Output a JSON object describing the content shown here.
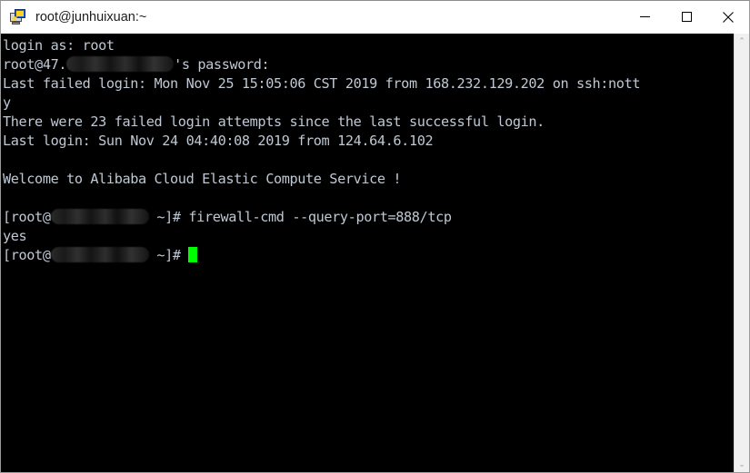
{
  "window": {
    "title": "root@junhuixuan:~",
    "icon": "putty-icon",
    "controls": {
      "minimize": "minimize-button",
      "maximize": "maximize-button",
      "close": "close-button"
    }
  },
  "terminal": {
    "background_color": "#000000",
    "text_color": "#bfc8d4",
    "cursor_color": "#00ff00",
    "lines": [
      {
        "id": "login-as",
        "text": "login as: root"
      },
      {
        "id": "password-prompt",
        "prefix": "root@47.",
        "redacted": true,
        "suffix": "'s password:"
      },
      {
        "id": "last-failed",
        "text": "Last failed login: Mon Nov 25 15:05:06 CST 2019 from 168.232.129.202 on ssh:nott"
      },
      {
        "id": "last-failed-wrap",
        "text": "y"
      },
      {
        "id": "failed-attempts",
        "text": "There were 23 failed login attempts since the last successful login."
      },
      {
        "id": "last-login",
        "text": "Last login: Sun Nov 24 04:40:08 2019 from 124.64.6.102"
      },
      {
        "id": "blank-1",
        "text": ""
      },
      {
        "id": "welcome",
        "text": "Welcome to Alibaba Cloud Elastic Compute Service !"
      },
      {
        "id": "blank-2",
        "text": ""
      },
      {
        "id": "command-line",
        "prefix": "[root@",
        "redacted": true,
        "suffix": " ~]# firewall-cmd --query-port=888/tcp"
      },
      {
        "id": "command-output",
        "text": "yes"
      },
      {
        "id": "active-prompt",
        "prefix": "[root@",
        "redacted": true,
        "suffix": " ~]# ",
        "cursor": true
      }
    ],
    "command": "firewall-cmd --query-port=888/tcp",
    "output": "yes"
  },
  "scrollbar": {
    "up_arrow": "⌃",
    "down_arrow": "⌄"
  }
}
